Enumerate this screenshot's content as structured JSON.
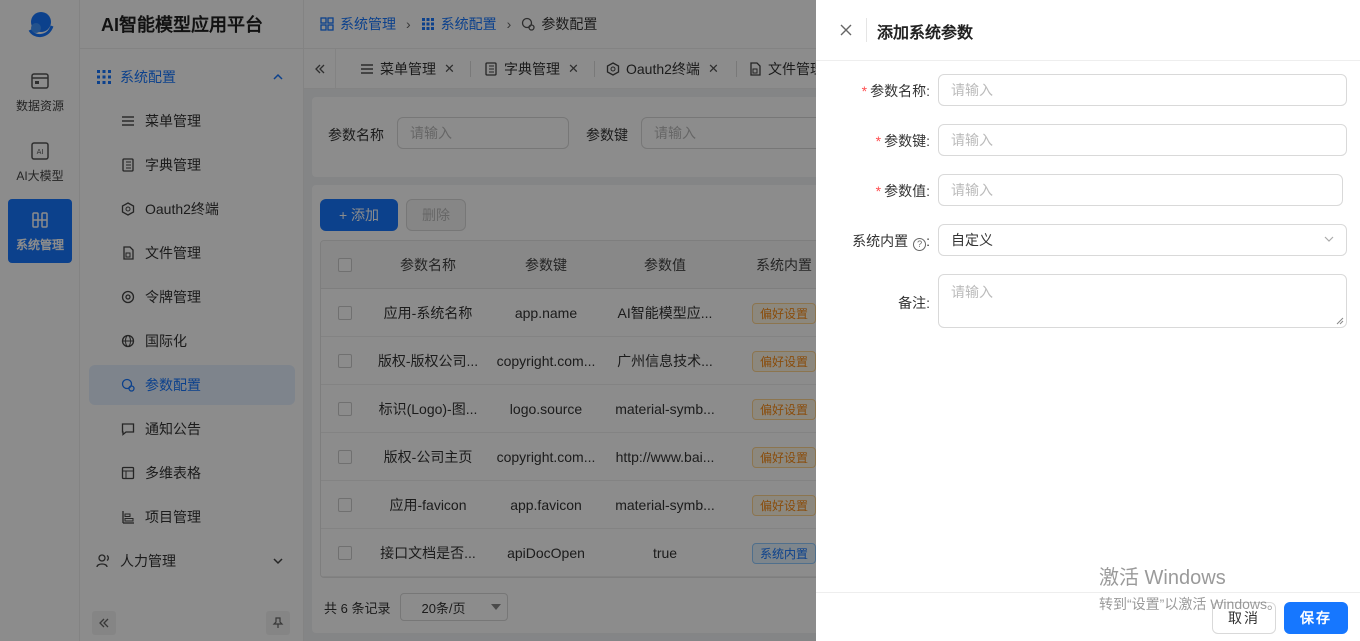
{
  "app": {
    "title": "AI智能模型应用平台"
  },
  "rail": [
    {
      "label": "数据资源"
    },
    {
      "label": "AI大模型"
    },
    {
      "label": "系统管理"
    }
  ],
  "menu": {
    "group_system": "系统配置",
    "items": [
      {
        "label": "菜单管理"
      },
      {
        "label": "字典管理"
      },
      {
        "label": "Oauth2终端"
      },
      {
        "label": "文件管理"
      },
      {
        "label": "令牌管理"
      },
      {
        "label": "国际化"
      },
      {
        "label": "参数配置"
      },
      {
        "label": "通知公告"
      },
      {
        "label": "多维表格"
      },
      {
        "label": "项目管理"
      }
    ],
    "group_hr": "人力管理"
  },
  "breadcrumb": [
    "系统管理",
    "系统配置",
    "参数配置"
  ],
  "tabs": [
    {
      "label": "菜单管理"
    },
    {
      "label": "字典管理"
    },
    {
      "label": "Oauth2终端"
    },
    {
      "label": "文件管理"
    }
  ],
  "search": {
    "name_label": "参数名称",
    "name_placeholder": "请输入",
    "key_label": "参数键",
    "key_placeholder": "请输入"
  },
  "toolbar": {
    "add_label": "+ 添加",
    "delete_label": "删除"
  },
  "table": {
    "headers": [
      "参数名称",
      "参数键",
      "参数值",
      "系统内置"
    ],
    "rows": [
      {
        "name": "应用-系统名称",
        "key": "app.name",
        "value": "AI智能模型应...",
        "type": "偏好设置"
      },
      {
        "name": "版权-版权公司...",
        "key": "copyright.com...",
        "value": "广州信息技术...",
        "type": "偏好设置"
      },
      {
        "name": "标识(Logo)-图...",
        "key": "logo.source",
        "value": "material-symb...",
        "type": "偏好设置"
      },
      {
        "name": "版权-公司主页",
        "key": "copyright.com...",
        "value": "http://www.bai...",
        "type": "偏好设置"
      },
      {
        "name": "应用-favicon",
        "key": "app.favicon",
        "value": "material-symb...",
        "type": "偏好设置"
      },
      {
        "name": "接口文档是否...",
        "key": "apiDocOpen",
        "value": "true",
        "type": "系统内置"
      }
    ]
  },
  "pager": {
    "total": "共 6 条记录",
    "size": "20条/页"
  },
  "drawer": {
    "title": "添加系统参数",
    "fields": {
      "name_label": "参数名称:",
      "name_placeholder": "请输入",
      "key_label": "参数键:",
      "key_placeholder": "请输入",
      "value_label": "参数值:",
      "value_placeholder": "请输入",
      "builtin_label": "系统内置",
      "builtin_colon": ":",
      "builtin_value": "自定义",
      "remark_label": "备注:",
      "remark_placeholder": "请输入"
    },
    "cancel_label": "取消",
    "save_label": "保存"
  },
  "watermark": {
    "line1": "激活 Windows",
    "line2": "转到“设置”以激活 Windows。"
  },
  "colors": {
    "accent": "#1677ff",
    "danger": "#ff4d4f",
    "tag_orange": "#fa8c16"
  }
}
